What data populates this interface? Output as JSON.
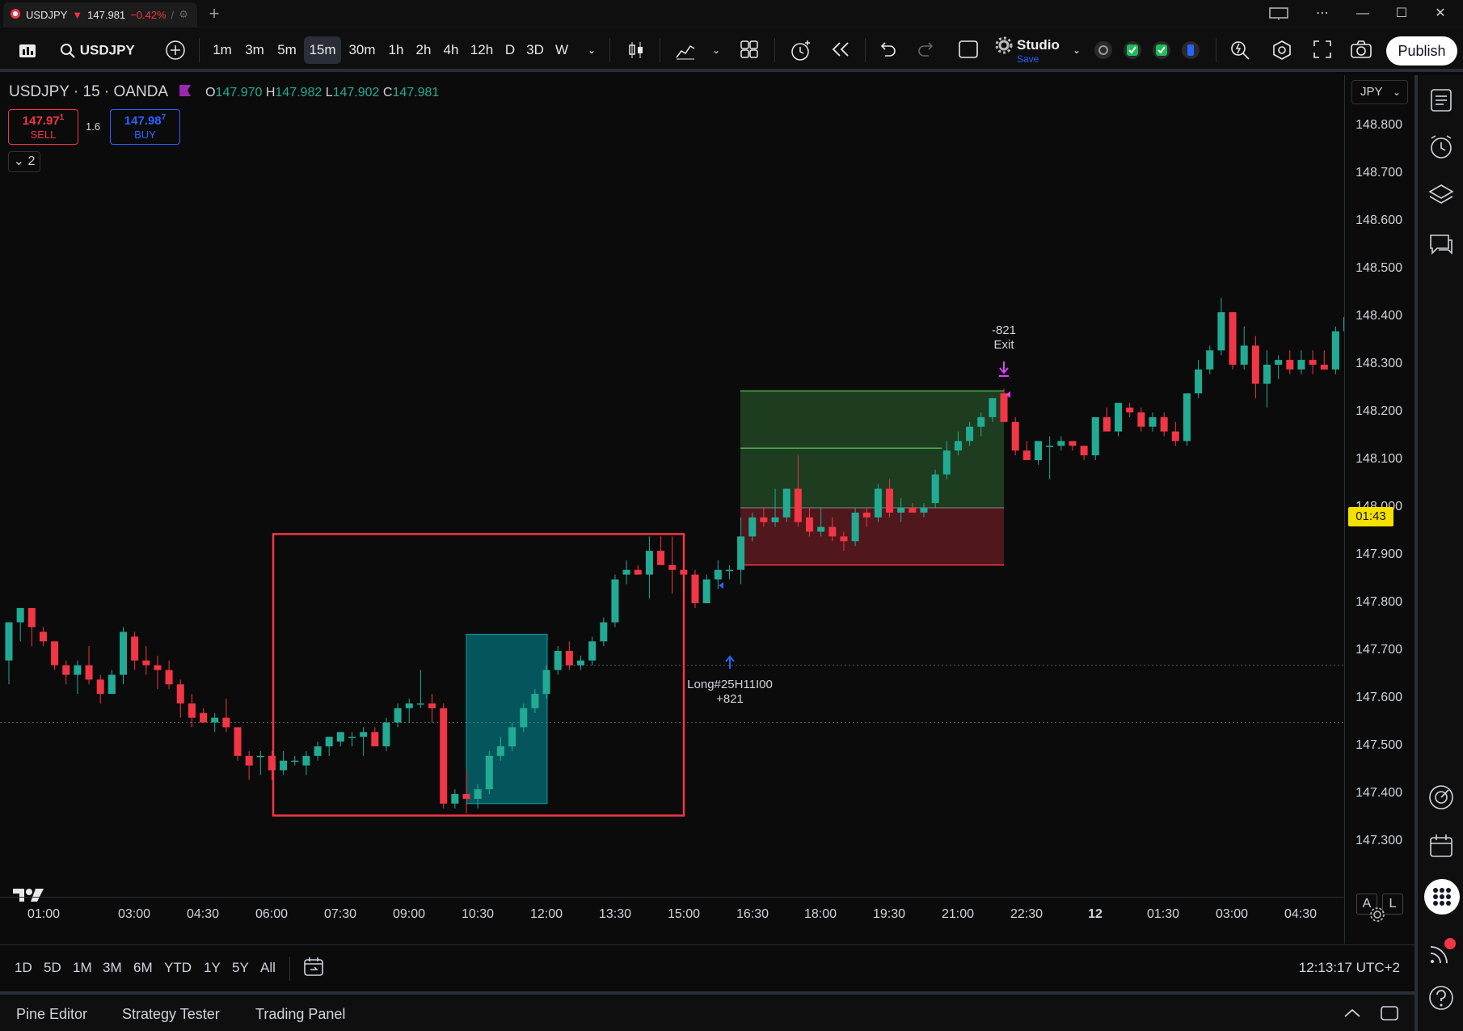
{
  "window": {
    "tab_symbol": "USDJPY",
    "tab_price": "147.981",
    "tab_change": "−0.42%",
    "tab_slash": "/",
    "new_tab": "+",
    "minimize": "—",
    "maximize": "☐",
    "close": "✕"
  },
  "toolbar": {
    "symbol": "USDJPY",
    "intervals": [
      "1m",
      "3m",
      "5m",
      "15m",
      "30m",
      "1h",
      "2h",
      "4h",
      "12h",
      "D",
      "3D",
      "W"
    ],
    "active_interval": "15m",
    "studio_label": "Studio",
    "studio_sub": "Save",
    "publish": "Publish"
  },
  "legend": {
    "title": "USDJPY · 15 · OANDA",
    "o_label": "O",
    "o": "147.970",
    "h_label": "H",
    "h": "147.982",
    "l_label": "L",
    "l": "147.902",
    "c_label": "C",
    "c": "147.981",
    "sell_price": "147.97",
    "sell_sup": "1",
    "sell_label": "SELL",
    "spread": "1.6",
    "buy_price": "147.98",
    "buy_sup": "7",
    "buy_label": "BUY",
    "indicators_toggle": "2"
  },
  "price_axis": {
    "currency": "JPY",
    "ticks": [
      "148.800",
      "148.700",
      "148.600",
      "148.500",
      "148.400",
      "148.300",
      "148.200",
      "148.100",
      "148.000",
      "147.900",
      "147.800",
      "147.700",
      "147.600",
      "147.500",
      "147.400",
      "147.300"
    ],
    "countdown": "01:43",
    "auto": "A",
    "log": "L"
  },
  "time_axis": {
    "ticks": [
      "01:00",
      "03:00",
      "04:30",
      "06:00",
      "07:30",
      "09:00",
      "10:30",
      "12:00",
      "13:30",
      "15:00",
      "16:30",
      "18:00",
      "19:30",
      "21:00",
      "22:30",
      "12",
      "01:30",
      "03:00",
      "04:30"
    ],
    "bold_tick": "12"
  },
  "annotations": {
    "exit_value": "-821",
    "exit_label": "Exit",
    "entry_label": "Long#25H11I00",
    "entry_value": "+821"
  },
  "chart_data": {
    "type": "candlestick",
    "symbol": "USDJPY",
    "interval": "15",
    "exchange": "OANDA",
    "ylim": [
      147.2,
      148.87
    ],
    "candles": [
      [
        147.68,
        147.76,
        147.63,
        147.76
      ],
      [
        147.76,
        147.79,
        147.72,
        147.79
      ],
      [
        147.79,
        147.79,
        147.71,
        147.75
      ],
      [
        147.74,
        147.75,
        147.71,
        147.72
      ],
      [
        147.72,
        147.72,
        147.66,
        147.67
      ],
      [
        147.67,
        147.68,
        147.63,
        147.65
      ],
      [
        147.65,
        147.68,
        147.61,
        147.67
      ],
      [
        147.67,
        147.71,
        147.63,
        147.64
      ],
      [
        147.64,
        147.65,
        147.59,
        147.61
      ],
      [
        147.61,
        147.66,
        147.61,
        147.65
      ],
      [
        147.65,
        147.75,
        147.63,
        147.74
      ],
      [
        147.73,
        147.74,
        147.66,
        147.68
      ],
      [
        147.68,
        147.71,
        147.65,
        147.67
      ],
      [
        147.67,
        147.69,
        147.62,
        147.66
      ],
      [
        147.66,
        147.68,
        147.62,
        147.63
      ],
      [
        147.63,
        147.64,
        147.56,
        147.59
      ],
      [
        147.59,
        147.61,
        147.54,
        147.56
      ],
      [
        147.57,
        147.58,
        147.55,
        147.55
      ],
      [
        147.55,
        147.57,
        147.53,
        147.56
      ],
      [
        147.56,
        147.6,
        147.53,
        147.54
      ],
      [
        147.54,
        147.54,
        147.47,
        147.48
      ],
      [
        147.48,
        147.49,
        147.43,
        147.46
      ],
      [
        147.48,
        147.49,
        147.44,
        147.48
      ],
      [
        147.48,
        147.49,
        147.43,
        147.45
      ],
      [
        147.45,
        147.49,
        147.44,
        147.47
      ],
      [
        147.47,
        147.48,
        147.46,
        147.47
      ],
      [
        147.46,
        147.49,
        147.44,
        147.48
      ],
      [
        147.48,
        147.51,
        147.47,
        147.5
      ],
      [
        147.5,
        147.52,
        147.48,
        147.52
      ],
      [
        147.51,
        147.53,
        147.5,
        147.53
      ],
      [
        147.52,
        147.53,
        147.5,
        147.52
      ],
      [
        147.52,
        147.54,
        147.48,
        147.53
      ],
      [
        147.53,
        147.54,
        147.5,
        147.5
      ],
      [
        147.5,
        147.56,
        147.49,
        147.55
      ],
      [
        147.55,
        147.59,
        147.54,
        147.58
      ],
      [
        147.58,
        147.6,
        147.55,
        147.59
      ],
      [
        147.59,
        147.66,
        147.58,
        147.59
      ],
      [
        147.59,
        147.61,
        147.55,
        147.58
      ],
      [
        147.58,
        147.59,
        147.37,
        147.38
      ],
      [
        147.38,
        147.41,
        147.37,
        147.4
      ],
      [
        147.4,
        147.45,
        147.36,
        147.39
      ],
      [
        147.39,
        147.42,
        147.37,
        147.41
      ],
      [
        147.41,
        147.49,
        147.4,
        147.48
      ],
      [
        147.48,
        147.52,
        147.47,
        147.5
      ],
      [
        147.5,
        147.55,
        147.49,
        147.54
      ],
      [
        147.54,
        147.59,
        147.53,
        147.58
      ],
      [
        147.58,
        147.62,
        147.57,
        147.61
      ],
      [
        147.61,
        147.67,
        147.6,
        147.66
      ],
      [
        147.66,
        147.71,
        147.65,
        147.7
      ],
      [
        147.7,
        147.72,
        147.66,
        147.67
      ],
      [
        147.67,
        147.69,
        147.66,
        147.68
      ],
      [
        147.68,
        147.73,
        147.67,
        147.72
      ],
      [
        147.72,
        147.77,
        147.71,
        147.76
      ],
      [
        147.76,
        147.86,
        147.75,
        147.85
      ],
      [
        147.86,
        147.89,
        147.84,
        147.87
      ],
      [
        147.87,
        147.88,
        147.86,
        147.86
      ],
      [
        147.86,
        147.94,
        147.81,
        147.91
      ],
      [
        147.91,
        147.94,
        147.88,
        147.88
      ],
      [
        147.88,
        147.94,
        147.82,
        147.87
      ],
      [
        147.87,
        147.94,
        147.86,
        147.86
      ],
      [
        147.86,
        147.87,
        147.79,
        147.8
      ],
      [
        147.8,
        147.86,
        147.8,
        147.85
      ],
      [
        147.85,
        147.89,
        147.83,
        147.87
      ],
      [
        147.87,
        147.88,
        147.85,
        147.87
      ],
      [
        147.87,
        147.98,
        147.84,
        147.94
      ],
      [
        147.94,
        147.99,
        147.93,
        147.98
      ],
      [
        147.98,
        148.0,
        147.96,
        147.97
      ],
      [
        147.97,
        148.04,
        147.96,
        147.98
      ],
      [
        147.98,
        148.04,
        147.97,
        148.04
      ],
      [
        148.04,
        148.11,
        147.96,
        147.97
      ],
      [
        147.98,
        148.0,
        147.94,
        147.95
      ],
      [
        147.95,
        148.0,
        147.94,
        147.96
      ],
      [
        147.96,
        147.98,
        147.93,
        147.94
      ],
      [
        147.94,
        147.95,
        147.91,
        147.93
      ],
      [
        147.93,
        148.0,
        147.92,
        147.99
      ],
      [
        147.99,
        148.0,
        147.96,
        147.98
      ],
      [
        147.98,
        148.05,
        147.97,
        148.04
      ],
      [
        148.04,
        148.06,
        147.98,
        147.99
      ],
      [
        147.99,
        148.02,
        147.97,
        148.0
      ],
      [
        148.0,
        148.01,
        147.99,
        147.99
      ],
      [
        147.99,
        148.01,
        147.98,
        148.0
      ],
      [
        148.01,
        148.08,
        148.0,
        148.07
      ],
      [
        148.07,
        148.14,
        148.06,
        148.12
      ],
      [
        148.12,
        148.16,
        148.11,
        148.14
      ],
      [
        148.14,
        148.18,
        148.13,
        148.17
      ],
      [
        148.17,
        148.2,
        148.15,
        148.19
      ],
      [
        148.19,
        148.23,
        148.18,
        148.23
      ],
      [
        148.24,
        148.25,
        148.18,
        148.18
      ],
      [
        148.18,
        148.19,
        148.11,
        148.12
      ],
      [
        148.12,
        148.14,
        148.1,
        148.1
      ],
      [
        148.1,
        148.14,
        148.09,
        148.14
      ],
      [
        148.13,
        148.15,
        148.06,
        148.13
      ],
      [
        148.13,
        148.15,
        148.12,
        148.14
      ],
      [
        148.14,
        148.14,
        148.12,
        148.13
      ],
      [
        148.13,
        148.13,
        148.1,
        148.11
      ],
      [
        148.11,
        148.19,
        148.1,
        148.19
      ],
      [
        148.19,
        148.21,
        148.16,
        148.16
      ],
      [
        148.16,
        148.22,
        148.15,
        148.22
      ],
      [
        148.21,
        148.22,
        148.19,
        148.2
      ],
      [
        148.2,
        148.21,
        148.16,
        148.17
      ],
      [
        148.17,
        148.2,
        148.16,
        148.19
      ],
      [
        148.19,
        148.2,
        148.15,
        148.16
      ],
      [
        148.16,
        148.18,
        148.13,
        148.14
      ],
      [
        148.14,
        148.24,
        148.13,
        148.24
      ],
      [
        148.24,
        148.31,
        148.23,
        148.29
      ],
      [
        148.29,
        148.34,
        148.28,
        148.33
      ],
      [
        148.33,
        148.44,
        148.32,
        148.41
      ],
      [
        148.41,
        148.41,
        148.29,
        148.3
      ],
      [
        148.3,
        148.38,
        148.29,
        148.34
      ],
      [
        148.34,
        148.36,
        148.23,
        148.26
      ],
      [
        148.26,
        148.33,
        148.21,
        148.3
      ],
      [
        148.3,
        148.32,
        148.27,
        148.31
      ],
      [
        148.31,
        148.33,
        148.28,
        148.29
      ],
      [
        148.29,
        148.33,
        148.28,
        148.31
      ],
      [
        148.31,
        148.33,
        148.28,
        148.3
      ],
      [
        148.3,
        148.33,
        148.29,
        148.29
      ],
      [
        148.29,
        148.38,
        148.28,
        148.37
      ],
      [
        148.37,
        148.41,
        148.36,
        148.4
      ]
    ],
    "drawings": {
      "rectangle_red": {
        "x_from_index": 29,
        "x_to_index": 62,
        "price_top": 147.945,
        "price_bottom": 147.355
      },
      "rectangle_teal": {
        "x_from_index": 42,
        "x_to_index": 48,
        "price_top": 147.735,
        "price_bottom": 147.38
      },
      "long_position": {
        "entry": 148.0,
        "target": 148.245,
        "stop": 147.88,
        "mid_line": 148.125
      },
      "dotted_levels": [
        147.67,
        147.55
      ],
      "entry_label": "Long#25H11I00",
      "exit_label": "Exit"
    }
  },
  "bottom": {
    "ranges": [
      "1D",
      "5D",
      "1M",
      "3M",
      "6M",
      "YTD",
      "1Y",
      "5Y",
      "All"
    ],
    "clock": "12:13:17 UTC+2",
    "tabs": [
      "Pine Editor",
      "Strategy Tester",
      "Trading Panel"
    ]
  },
  "colors": {
    "up": "#22ab94",
    "down": "#f23645",
    "accent": "#2962ff",
    "countdown": "#f5e000"
  }
}
